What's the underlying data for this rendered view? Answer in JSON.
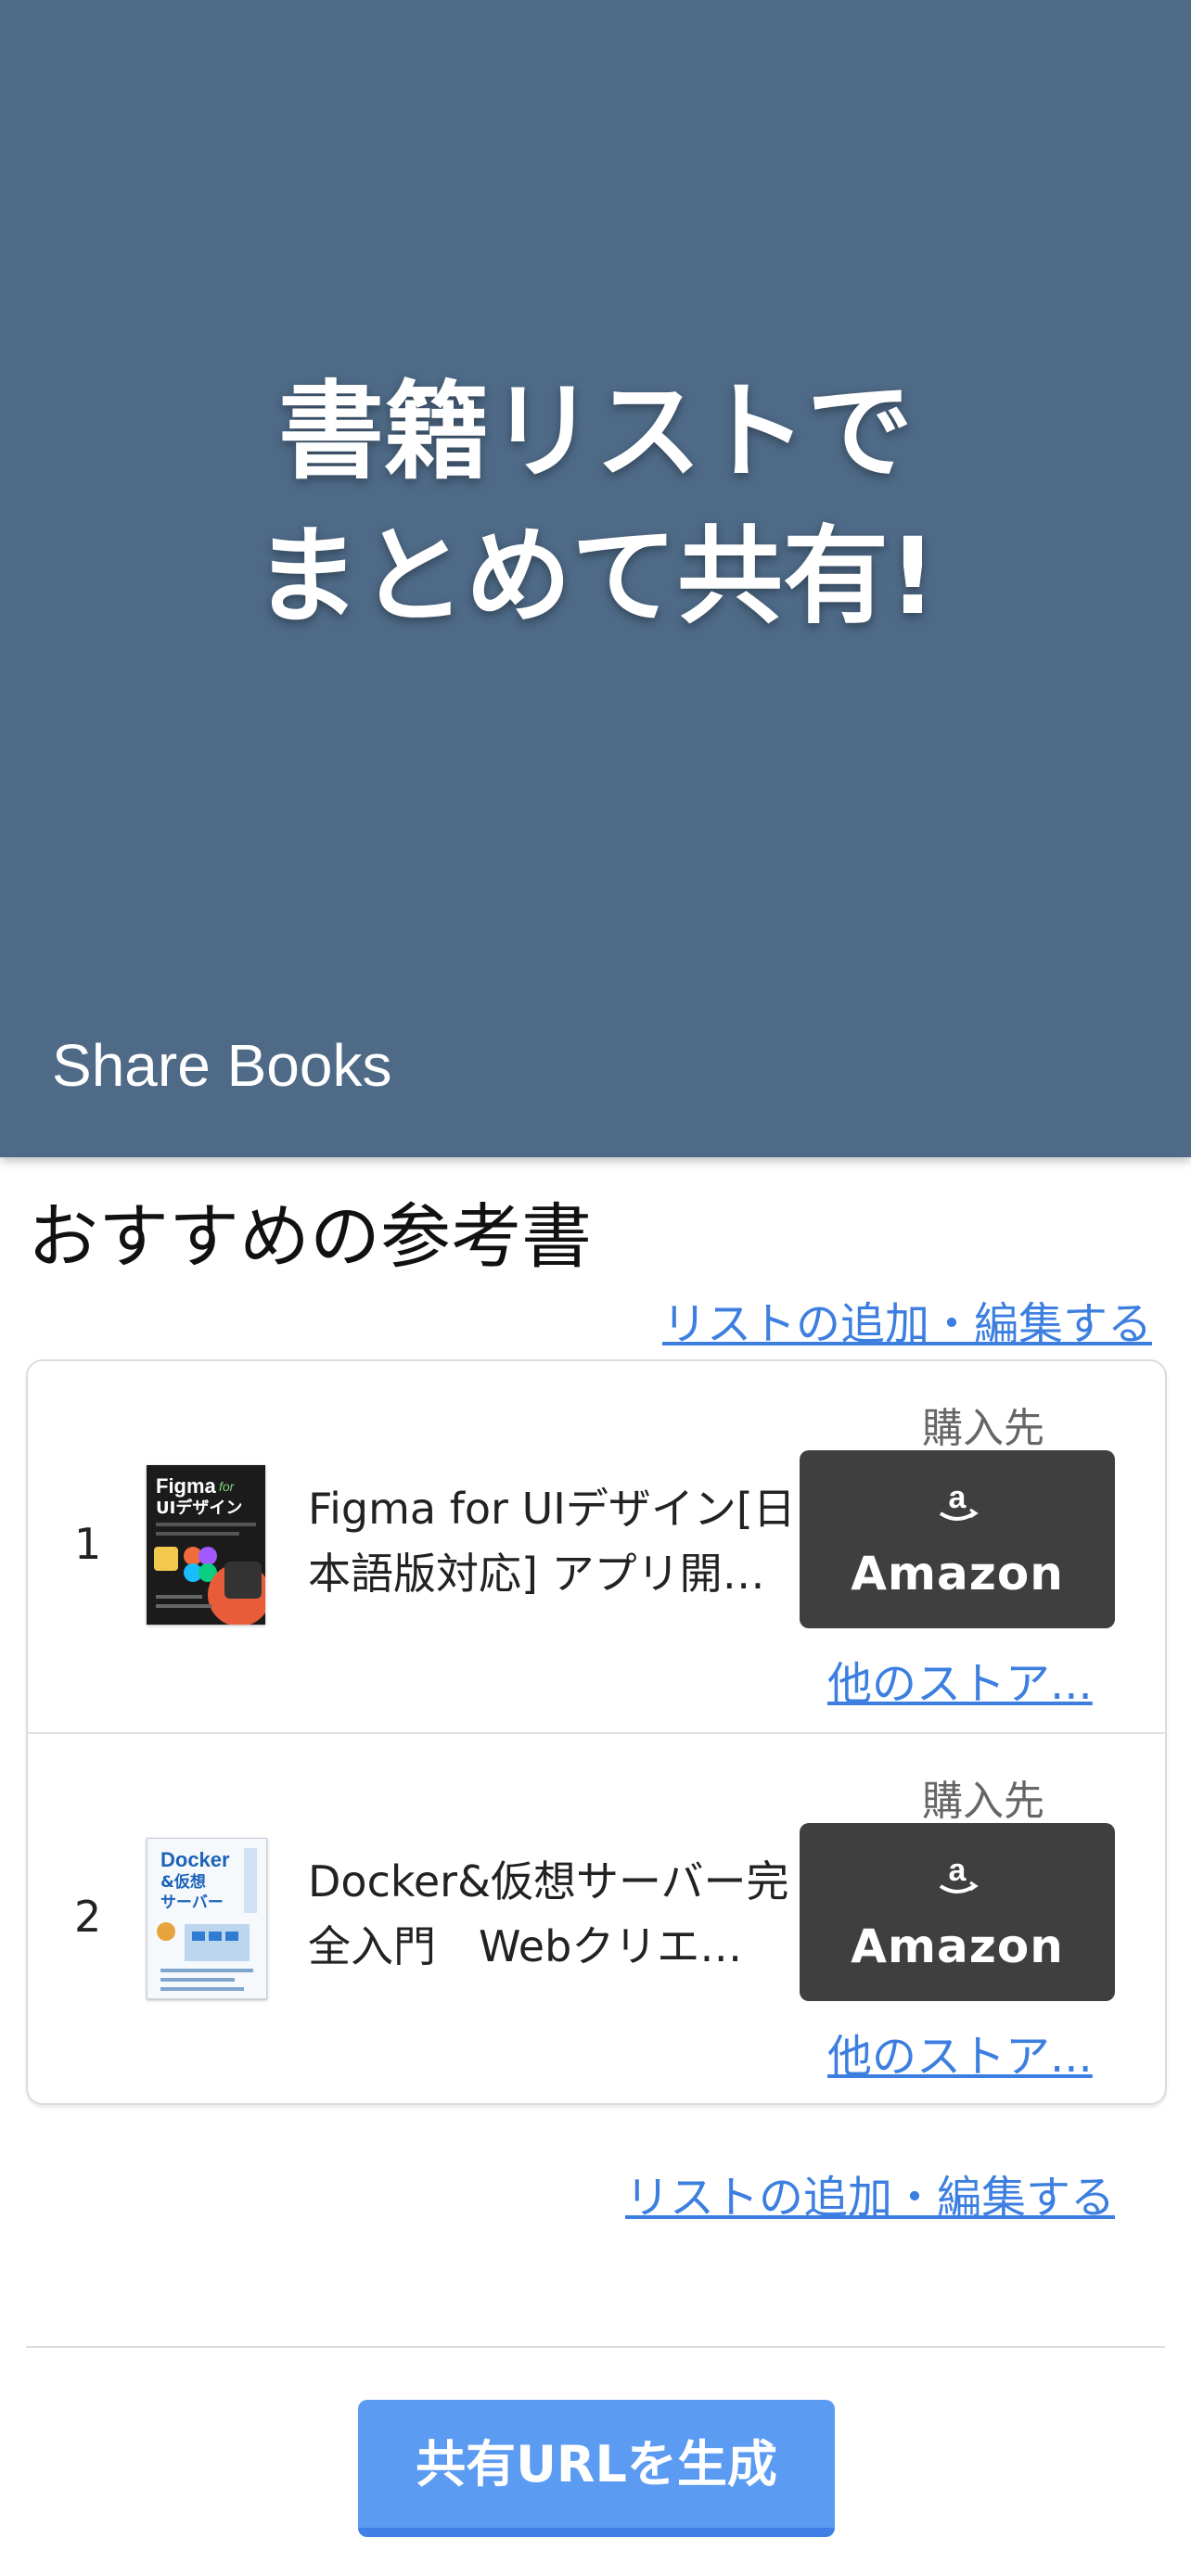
{
  "hero": {
    "title_line1": "書籍リストで",
    "title_line2": "まとめて共有!",
    "app_name": "Share Books",
    "background_color": "#4e6a87"
  },
  "section": {
    "title": "おすすめの参考書",
    "edit_link_top": "リストの追加・編集する",
    "edit_link_bottom": "リストの追加・編集する"
  },
  "books": [
    {
      "rank": "1",
      "title": "Figma for UIデザイン[日本語版対応] アプリ開…",
      "cover_text": "Figma for UIデザイン",
      "buy_label": "購入先",
      "store_logo": "a",
      "store_button": "Amazon",
      "other_store": "他のストア..."
    },
    {
      "rank": "2",
      "title": "Docker&仮想サーバー完全入門　Webクリエ…",
      "cover_text": "Docker&仮想サーバー",
      "buy_label": "購入先",
      "store_logo": "a",
      "store_button": "Amazon",
      "other_store": "他のストア..."
    }
  ],
  "actions": {
    "generate_button": "共有URLを生成",
    "accent_color": "#5c9bf2",
    "link_color": "#3d7fe0"
  }
}
